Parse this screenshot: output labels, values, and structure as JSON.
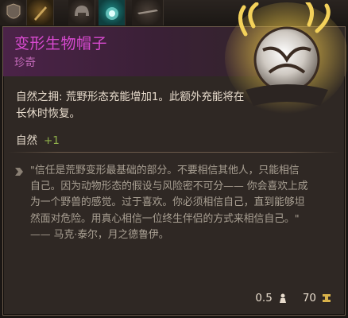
{
  "inventory_strip": {
    "slots": [
      {
        "icon": "armor-icon"
      },
      {
        "icon": "weapon-icon"
      },
      {
        "icon": "helmet-icon"
      },
      {
        "icon": "amulet-icon"
      },
      {
        "icon": "weapon-icon"
      }
    ]
  },
  "tooltip": {
    "title": "变形生物帽子",
    "rarity": "珍奇",
    "description": "自然之拥: 荒野形态充能增加1。此额外充能将在长休时恢复。",
    "boost": {
      "name": "自然",
      "value": "+1"
    },
    "lore": "\"信任是荒野变形最基础的部分。不要相信其他人，只能相信自己。因为动物形态的假设与风险密不可分—— 你会喜欢上成为一个野兽的感觉。过于喜欢。你必须相信自己，直到能够坦然面对危险。用真心相信一位终生伴侣的方式来相信自己。\" —— 马克·泰尔，月之德鲁伊。",
    "weight": "0.5",
    "value": "70",
    "colors": {
      "title": "#d84ad0",
      "rarity": "#c36ab9",
      "boost_value": "#8fb04a",
      "gold": "#d8b24a"
    }
  }
}
